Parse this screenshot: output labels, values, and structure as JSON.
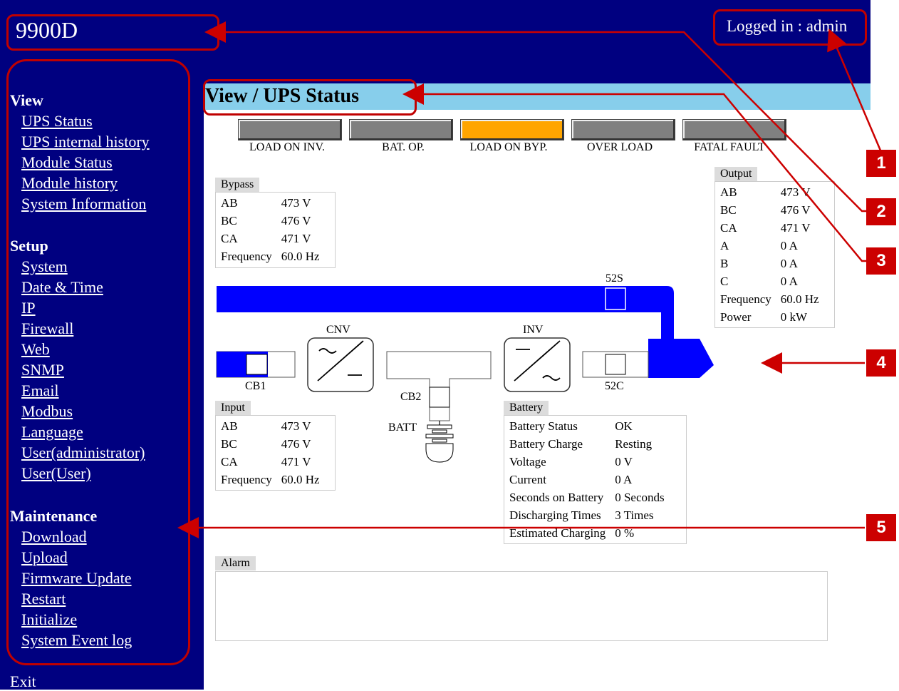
{
  "header": {
    "app_title": "9900D",
    "login_text": "Logged in : admin"
  },
  "sidebar": {
    "sections": [
      {
        "title": "View",
        "items": [
          "UPS Status",
          "UPS internal history",
          "Module Status",
          "Module history",
          "System Information"
        ]
      },
      {
        "title": "Setup",
        "items": [
          "System",
          "Date & Time",
          "IP",
          "Firewall",
          "Web",
          "SNMP",
          "Email",
          "Modbus",
          "Language",
          "User(administrator)",
          "User(User)"
        ]
      },
      {
        "title": "Maintenance",
        "items": [
          "Download",
          "Upload",
          "Firmware Update",
          "Restart",
          "Initialize",
          "System Event log"
        ]
      }
    ],
    "exit_label": "Exit"
  },
  "page": {
    "title": "View / UPS Status"
  },
  "indicators": [
    {
      "label": "LOAD ON INV.",
      "color": "#808080"
    },
    {
      "label": "BAT. OP.",
      "color": "#808080"
    },
    {
      "label": "LOAD ON BYP.",
      "color": "#ffa500"
    },
    {
      "label": "OVER LOAD",
      "color": "#808080"
    },
    {
      "label": "FATAL FAULT",
      "color": "#808080"
    }
  ],
  "bypass": {
    "title": "Bypass",
    "rows": [
      [
        "AB",
        "473 V"
      ],
      [
        "BC",
        "476 V"
      ],
      [
        "CA",
        "471 V"
      ],
      [
        "Frequency",
        "60.0 Hz"
      ]
    ]
  },
  "input": {
    "title": "Input",
    "rows": [
      [
        "AB",
        "473 V"
      ],
      [
        "BC",
        "476 V"
      ],
      [
        "CA",
        "471 V"
      ],
      [
        "Frequency",
        "60.0 Hz"
      ]
    ]
  },
  "output": {
    "title": "Output",
    "rows": [
      [
        "AB",
        "473 V"
      ],
      [
        "BC",
        "476 V"
      ],
      [
        "CA",
        "471 V"
      ],
      [
        "A",
        "0 A"
      ],
      [
        "B",
        "0 A"
      ],
      [
        "C",
        "0 A"
      ],
      [
        "Frequency",
        "60.0 Hz"
      ],
      [
        "Power",
        "0 kW"
      ]
    ]
  },
  "battery": {
    "title": "Battery",
    "rows": [
      [
        "Battery Status",
        "OK"
      ],
      [
        "Battery Charge",
        "Resting"
      ],
      [
        "Voltage",
        "0 V"
      ],
      [
        "Current",
        "0 A"
      ],
      [
        "Seconds on Battery",
        "0 Seconds"
      ],
      [
        "Discharging Times",
        "3 Times"
      ],
      [
        "Estimated Charging",
        "0 %"
      ]
    ]
  },
  "alarm": {
    "title": "Alarm"
  },
  "diagram": {
    "s52s": "52S",
    "s52c": "52C",
    "cnv": "CNV",
    "inv": "INV",
    "cb1": "CB1",
    "cb2": "CB2",
    "batt": "BATT",
    "flow_color": "#0000ff"
  },
  "callouts": [
    "1",
    "2",
    "3",
    "4",
    "5"
  ],
  "colors": {
    "navy": "#000080",
    "title_bar": "#87ceeb",
    "annotation": "#cc0000"
  }
}
